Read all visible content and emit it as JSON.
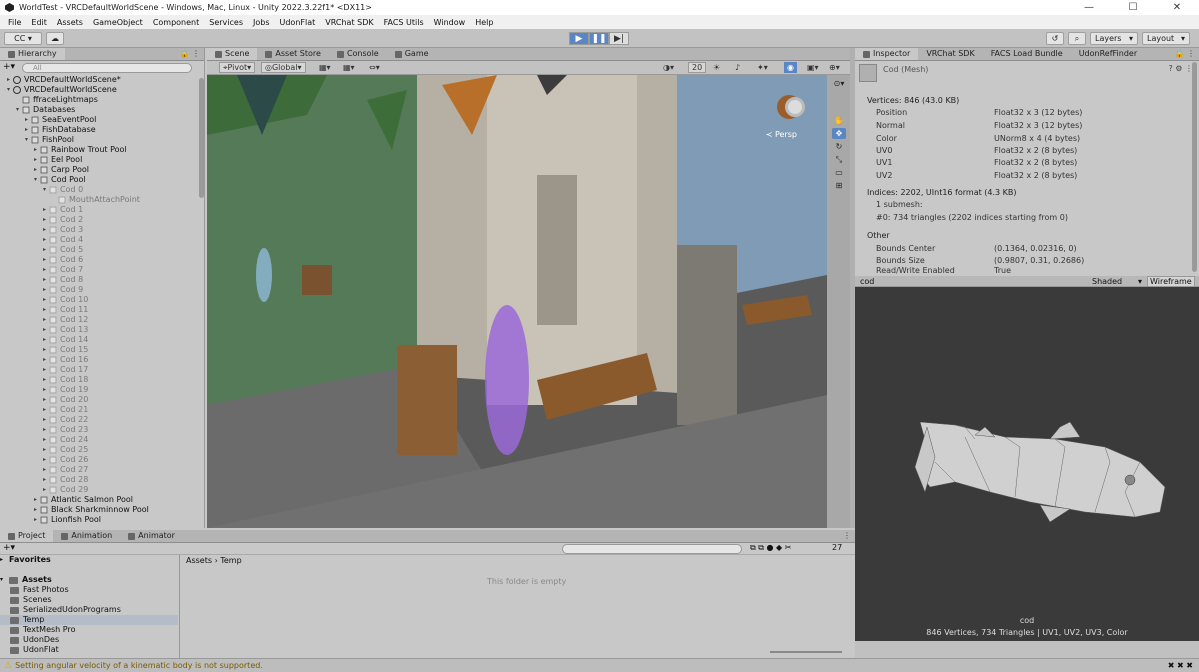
{
  "window": {
    "title": "WorldTest - VRCDefaultWorldScene - Windows, Mac, Linux - Unity 2022.3.22f1* <DX11>",
    "min": "—",
    "max": "☐",
    "close": "✕"
  },
  "menu": [
    "File",
    "Edit",
    "Assets",
    "GameObject",
    "Component",
    "Services",
    "Jobs",
    "UdonFlat",
    "VRChat SDK",
    "FACS Utils",
    "Window",
    "Help"
  ],
  "toolbar": {
    "account": "CC ▾",
    "layers": "Layers",
    "layout": "Layout"
  },
  "hierarchy": {
    "tab": "Hierarchy",
    "search_placeholder": "All",
    "rows": [
      {
        "label": "VRCDefaultWorldScene*",
        "indent": 0,
        "arrow": "▸",
        "type": "scene",
        "dim": false
      },
      {
        "label": "VRCDefaultWorldScene",
        "indent": 0,
        "arrow": "▾",
        "type": "scene",
        "dim": false
      },
      {
        "label": "ffraceLightmaps",
        "indent": 1,
        "arrow": "",
        "type": "obj",
        "dim": false
      },
      {
        "label": "Databases",
        "indent": 1,
        "arrow": "▾",
        "type": "obj",
        "dim": false
      },
      {
        "label": "SeaEventPool",
        "indent": 2,
        "arrow": "▸",
        "type": "obj",
        "dim": false
      },
      {
        "label": "FishDatabase",
        "indent": 2,
        "arrow": "▸",
        "type": "obj",
        "dim": false
      },
      {
        "label": "FishPool",
        "indent": 2,
        "arrow": "▾",
        "type": "obj",
        "dim": false
      },
      {
        "label": "Rainbow Trout Pool",
        "indent": 3,
        "arrow": "▸",
        "type": "obj",
        "dim": false
      },
      {
        "label": "Eel Pool",
        "indent": 3,
        "arrow": "▸",
        "type": "obj",
        "dim": false
      },
      {
        "label": "Carp Pool",
        "indent": 3,
        "arrow": "▸",
        "type": "obj",
        "dim": false
      },
      {
        "label": "Cod Pool",
        "indent": 3,
        "arrow": "▾",
        "type": "obj",
        "dim": false
      },
      {
        "label": "Cod 0",
        "indent": 4,
        "arrow": "▾",
        "type": "obj",
        "dim": true
      },
      {
        "label": "MouthAttachPoint",
        "indent": 5,
        "arrow": "",
        "type": "obj",
        "dim": true
      },
      {
        "label": "Cod 1",
        "indent": 4,
        "arrow": "▸",
        "type": "obj",
        "dim": true
      },
      {
        "label": "Cod 2",
        "indent": 4,
        "arrow": "▸",
        "type": "obj",
        "dim": true
      },
      {
        "label": "Cod 3",
        "indent": 4,
        "arrow": "▸",
        "type": "obj",
        "dim": true
      },
      {
        "label": "Cod 4",
        "indent": 4,
        "arrow": "▸",
        "type": "obj",
        "dim": true
      },
      {
        "label": "Cod 5",
        "indent": 4,
        "arrow": "▸",
        "type": "obj",
        "dim": true
      },
      {
        "label": "Cod 6",
        "indent": 4,
        "arrow": "▸",
        "type": "obj",
        "dim": true
      },
      {
        "label": "Cod 7",
        "indent": 4,
        "arrow": "▸",
        "type": "obj",
        "dim": true
      },
      {
        "label": "Cod 8",
        "indent": 4,
        "arrow": "▸",
        "type": "obj",
        "dim": true
      },
      {
        "label": "Cod 9",
        "indent": 4,
        "arrow": "▸",
        "type": "obj",
        "dim": true
      },
      {
        "label": "Cod 10",
        "indent": 4,
        "arrow": "▸",
        "type": "obj",
        "dim": true
      },
      {
        "label": "Cod 11",
        "indent": 4,
        "arrow": "▸",
        "type": "obj",
        "dim": true
      },
      {
        "label": "Cod 12",
        "indent": 4,
        "arrow": "▸",
        "type": "obj",
        "dim": true
      },
      {
        "label": "Cod 13",
        "indent": 4,
        "arrow": "▸",
        "type": "obj",
        "dim": true
      },
      {
        "label": "Cod 14",
        "indent": 4,
        "arrow": "▸",
        "type": "obj",
        "dim": true
      },
      {
        "label": "Cod 15",
        "indent": 4,
        "arrow": "▸",
        "type": "obj",
        "dim": true
      },
      {
        "label": "Cod 16",
        "indent": 4,
        "arrow": "▸",
        "type": "obj",
        "dim": true
      },
      {
        "label": "Cod 17",
        "indent": 4,
        "arrow": "▸",
        "type": "obj",
        "dim": true
      },
      {
        "label": "Cod 18",
        "indent": 4,
        "arrow": "▸",
        "type": "obj",
        "dim": true
      },
      {
        "label": "Cod 19",
        "indent": 4,
        "arrow": "▸",
        "type": "obj",
        "dim": true
      },
      {
        "label": "Cod 20",
        "indent": 4,
        "arrow": "▸",
        "type": "obj",
        "dim": true
      },
      {
        "label": "Cod 21",
        "indent": 4,
        "arrow": "▸",
        "type": "obj",
        "dim": true
      },
      {
        "label": "Cod 22",
        "indent": 4,
        "arrow": "▸",
        "type": "obj",
        "dim": true
      },
      {
        "label": "Cod 23",
        "indent": 4,
        "arrow": "▸",
        "type": "obj",
        "dim": true
      },
      {
        "label": "Cod 24",
        "indent": 4,
        "arrow": "▸",
        "type": "obj",
        "dim": true
      },
      {
        "label": "Cod 25",
        "indent": 4,
        "arrow": "▸",
        "type": "obj",
        "dim": true
      },
      {
        "label": "Cod 26",
        "indent": 4,
        "arrow": "▸",
        "type": "obj",
        "dim": true
      },
      {
        "label": "Cod 27",
        "indent": 4,
        "arrow": "▸",
        "type": "obj",
        "dim": true
      },
      {
        "label": "Cod 28",
        "indent": 4,
        "arrow": "▸",
        "type": "obj",
        "dim": true
      },
      {
        "label": "Cod 29",
        "indent": 4,
        "arrow": "▸",
        "type": "obj",
        "dim": true
      },
      {
        "label": "Atlantic Salmon Pool",
        "indent": 3,
        "arrow": "▸",
        "type": "obj",
        "dim": false
      },
      {
        "label": "Black Sharkminnow Pool",
        "indent": 3,
        "arrow": "▸",
        "type": "obj",
        "dim": false
      },
      {
        "label": "Lionfish Pool",
        "indent": 3,
        "arrow": "▸",
        "type": "obj",
        "dim": false
      }
    ]
  },
  "scene": {
    "tabs": [
      "Scene",
      "Asset Store",
      "Console",
      "Game"
    ],
    "pivot": "Pivot",
    "global": "Global",
    "grid_size": "20",
    "persp": "≺ Persp"
  },
  "inspector": {
    "tabs": [
      "Inspector",
      "VRChat SDK",
      "FACS Load Bundle",
      "UdonRefFinder"
    ],
    "title": "Cod (Mesh)",
    "vertices_header": "Vertices: 846 (43.0 KB)",
    "attributes": [
      {
        "k": "Position",
        "v": "Float32 x 3 (12 bytes)"
      },
      {
        "k": "Normal",
        "v": "Float32 x 3 (12 bytes)"
      },
      {
        "k": "Color",
        "v": "UNorm8 x 4 (4 bytes)"
      },
      {
        "k": "UV0",
        "v": "Float32 x 2 (8 bytes)"
      },
      {
        "k": "UV1",
        "v": "Float32 x 2 (8 bytes)"
      },
      {
        "k": "UV2",
        "v": "Float32 x 2 (8 bytes)"
      }
    ],
    "indices_header": "Indices: 2202, UInt16 format (4.3 KB)",
    "submesh": "1 submesh:",
    "submesh_detail": "#0: 734 triangles (2202 indices starting from 0)",
    "other_header": "Other",
    "bounds_center_k": "Bounds Center",
    "bounds_center_v": "(0.1364, 0.02316, 0)",
    "bounds_size_k": "Bounds Size",
    "bounds_size_v": "(0.9807, 0.31, 0.2686)",
    "readwrite_k": "Read/Write Enabled",
    "readwrite_v": "True"
  },
  "preview": {
    "name": "cod",
    "shading": "Shaded",
    "wireframe": "Wireframe",
    "caption_name": "cod",
    "caption_stats": "846 Vertices, 734 Triangles | UV1, UV2, UV3, Color"
  },
  "project": {
    "tabs": [
      "Project",
      "Animation",
      "Animator"
    ],
    "favorites": "Favorites",
    "assets": "Assets",
    "folders": [
      "Fast Photos",
      "Scenes",
      "SerializedUdonPrograms",
      "Temp",
      "TextMesh Pro",
      "UdonDes",
      "UdonFlat"
    ],
    "breadcrumb_root": "Assets",
    "breadcrumb_sep": "›",
    "breadcrumb_leaf": "Temp",
    "empty_text": "This folder is empty",
    "count": "27"
  },
  "status": {
    "message": "Setting angular velocity of a kinematic body is not supported."
  },
  "colors": {
    "accent": "#5a86c4",
    "warning": "#e0a800",
    "selection": "#b4bcc8"
  }
}
